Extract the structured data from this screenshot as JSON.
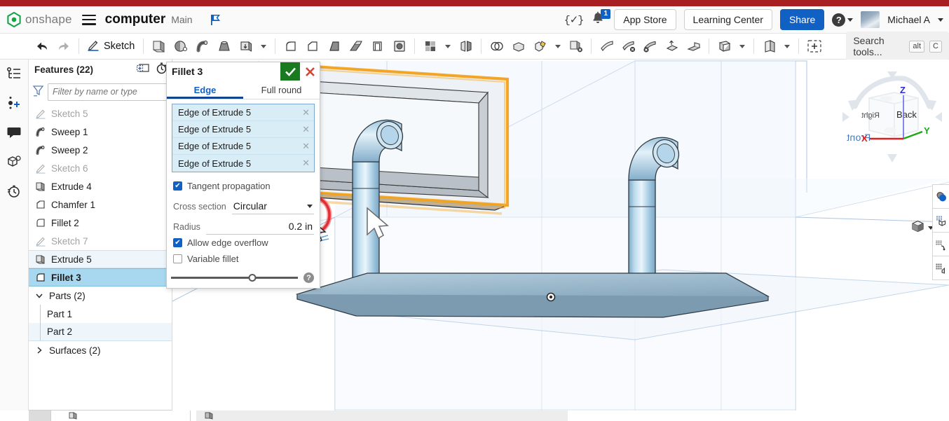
{
  "header": {
    "brand": "onshape",
    "brand_color": "#17a34a",
    "menu_icon": "hamburger-icon",
    "document_title": "computer",
    "workspace": "Main",
    "branch_icon": "branch-flag-icon",
    "featurescript_icon": "{✓}",
    "notifications_icon": "bell-icon",
    "notification_count": "1",
    "app_store_label": "App Store",
    "learning_center_label": "Learning Center",
    "share_label": "Share",
    "share_color": "#1160c4",
    "help_icon": "question-mark-icon",
    "user_name": "Michael A",
    "top_strip_color": "#a81f23"
  },
  "toolbar": {
    "undo_icon": "undo-arrow-icon",
    "redo_icon": "redo-arrow-icon",
    "sketch_label": "Sketch",
    "sketch_icon": "pencil-icon",
    "tools": [
      {
        "name": "extrude-icon"
      },
      {
        "name": "revolve-icon"
      },
      {
        "name": "sweep-icon"
      },
      {
        "name": "loft-icon"
      },
      {
        "name": "thicken-icon"
      },
      {
        "name": "fillet-icon"
      },
      {
        "name": "chamfer-icon"
      },
      {
        "name": "draft-icon"
      },
      {
        "name": "rib-icon"
      },
      {
        "name": "shell-icon"
      },
      {
        "name": "hole-icon"
      },
      {
        "name": "linear-pattern-icon"
      },
      {
        "name": "mirror-icon"
      },
      {
        "name": "boolean-icon"
      },
      {
        "name": "split-icon"
      },
      {
        "name": "transform-icon"
      },
      {
        "name": "delete-part-icon"
      },
      {
        "name": "sheet-metal-icon"
      },
      {
        "name": "delete-face-icon"
      },
      {
        "name": "move-face-icon"
      },
      {
        "name": "replace-face-icon"
      },
      {
        "name": "plane-icon"
      },
      {
        "name": "derive-icon"
      },
      {
        "name": "insert-part-icon"
      }
    ],
    "search_placeholder": "Search tools...",
    "search_kbd_alt": "alt",
    "search_kbd_key": "C"
  },
  "left_rail": [
    {
      "name": "feature-list-icon"
    },
    {
      "name": "add-variable-icon"
    },
    {
      "name": "comments-icon"
    },
    {
      "name": "part-info-icon"
    },
    {
      "name": "history-icon"
    }
  ],
  "features_panel": {
    "title": "Features (22)",
    "new_folder_icon": "new-folder-icon",
    "rollback_icon": "rollback-timer-icon",
    "filter_icon": "funnel-icon",
    "filter_placeholder": "Filter by name or type",
    "items": [
      {
        "label": "Sketch 5",
        "icon": "sketch-icon",
        "state": "dim"
      },
      {
        "label": "Sweep 1",
        "icon": "sweep-icon",
        "state": "normal"
      },
      {
        "label": "Sweep 2",
        "icon": "sweep-icon",
        "state": "normal"
      },
      {
        "label": "Sketch 6",
        "icon": "sketch-icon",
        "state": "dim"
      },
      {
        "label": "Extrude 4",
        "icon": "extrude-icon",
        "state": "normal"
      },
      {
        "label": "Chamfer 1",
        "icon": "chamfer-icon",
        "state": "normal"
      },
      {
        "label": "Fillet 2",
        "icon": "fillet-icon",
        "state": "normal"
      },
      {
        "label": "Sketch 7",
        "icon": "sketch-icon",
        "state": "dim"
      },
      {
        "label": "Extrude 5",
        "icon": "extrude-icon",
        "state": "highlight"
      },
      {
        "label": "Fillet 3",
        "icon": "fillet-icon",
        "state": "selected"
      }
    ],
    "parts_group": {
      "label": "Parts (2)",
      "expanded": true,
      "children": [
        {
          "label": "Part 1",
          "state": "normal"
        },
        {
          "label": "Part 2",
          "state": "highlight"
        }
      ]
    },
    "surfaces_group": {
      "label": "Surfaces (2)",
      "expanded": false
    }
  },
  "fillet_dialog": {
    "title": "Fillet 3",
    "accept_icon": "checkmark-icon",
    "accept_color": "#1a7a1f",
    "cancel_icon": "close-x-icon",
    "cancel_color": "#e0412a",
    "tabs": [
      {
        "label": "Edge",
        "active": true
      },
      {
        "label": "Full round",
        "active": false
      }
    ],
    "entities": [
      {
        "label": "Edge of Extrude 5",
        "remove_icon": "remove-x-icon"
      },
      {
        "label": "Edge of Extrude 5",
        "remove_icon": "remove-x-icon"
      },
      {
        "label": "Edge of Extrude 5",
        "remove_icon": "remove-x-icon"
      },
      {
        "label": "Edge of Extrude 5",
        "remove_icon": "remove-x-icon"
      }
    ],
    "tangent_propagation": {
      "label": "Tangent propagation",
      "checked": true
    },
    "cross_section": {
      "label": "Cross section",
      "value": "Circular",
      "dropdown_icon": "chevron-down-icon"
    },
    "radius": {
      "label": "Radius",
      "value": "0.2 in"
    },
    "allow_edge_overflow": {
      "label": "Allow edge overflow",
      "checked": true
    },
    "variable_fillet": {
      "label": "Variable fillet",
      "checked": false
    },
    "slider_position_pct": "64",
    "help_icon": "question-help-icon"
  },
  "viewport": {
    "plane_label": "Front",
    "plane_label_color": "#4a7ab5",
    "selection_highlight_color": "#f5a623",
    "cursor_marker_color": "#e8323c",
    "cursor_icon": "arrow-cursor-icon",
    "model": {
      "frame_color": "#e8eef3",
      "pipe_color": "#a9cde4",
      "base_color": "#9fb8cb"
    },
    "view_cube": {
      "face_right": "Right",
      "face_back": "Back",
      "axis_x": "X",
      "axis_y": "Y",
      "axis_z": "Z",
      "axis_x_color": "#e02020",
      "axis_y_color": "#1aa81a",
      "axis_z_color": "#3a3ad0",
      "arrow_icons": [
        "rotate-left-arrow",
        "rotate-right-arrow",
        "pan-left-arrow",
        "pan-right-arrow",
        "pan-up-arrow",
        "pan-down-arrow"
      ]
    },
    "display_control": {
      "icon": "shaded-cube-icon",
      "dropdown_icon": "chevron-down-icon"
    },
    "right_tools": [
      {
        "name": "appearance-icon"
      },
      {
        "name": "section-view-icon"
      },
      {
        "name": "measure-grid-icon"
      },
      {
        "name": "mass-properties-icon"
      }
    ]
  }
}
